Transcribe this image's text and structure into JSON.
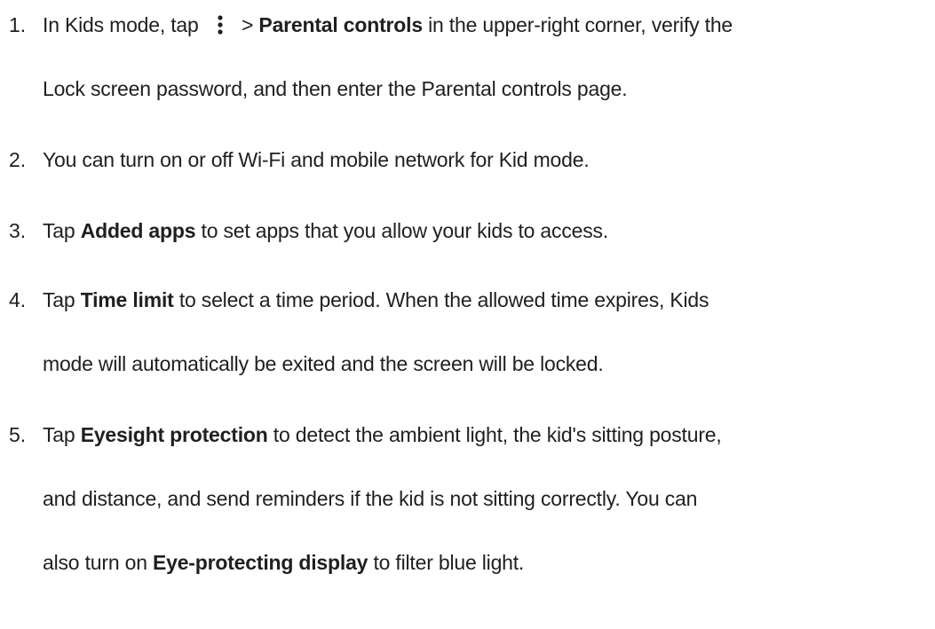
{
  "steps": [
    {
      "number": "1.",
      "parts": {
        "a": "In Kids mode, tap",
        "b": " > ",
        "c": "Parental controls",
        "d": " in the upper-right corner, verify the",
        "e": "Lock screen password, and then enter the Parental controls page."
      },
      "icon": "more-vertical-icon"
    },
    {
      "number": "2.",
      "parts": {
        "a": "You can turn on or off Wi-Fi and mobile network for Kid mode."
      }
    },
    {
      "number": "3.",
      "parts": {
        "a": "Tap ",
        "b": "Added apps",
        "c": " to set apps that you allow your kids to access."
      }
    },
    {
      "number": "4.",
      "parts": {
        "a": "Tap ",
        "b": "Time limit",
        "c": " to select a time period. When the allowed time expires, Kids",
        "d": "mode will automatically be exited and the screen will be locked."
      }
    },
    {
      "number": "5.",
      "parts": {
        "a": "Tap ",
        "b": "Eyesight protection",
        "c": " to detect the ambient light, the kid's sitting posture,",
        "d": "and distance, and send reminders if the kid is not sitting correctly. You can",
        "e": "also turn on ",
        "f": "Eye-protecting display",
        "g": " to filter blue light."
      }
    }
  ]
}
